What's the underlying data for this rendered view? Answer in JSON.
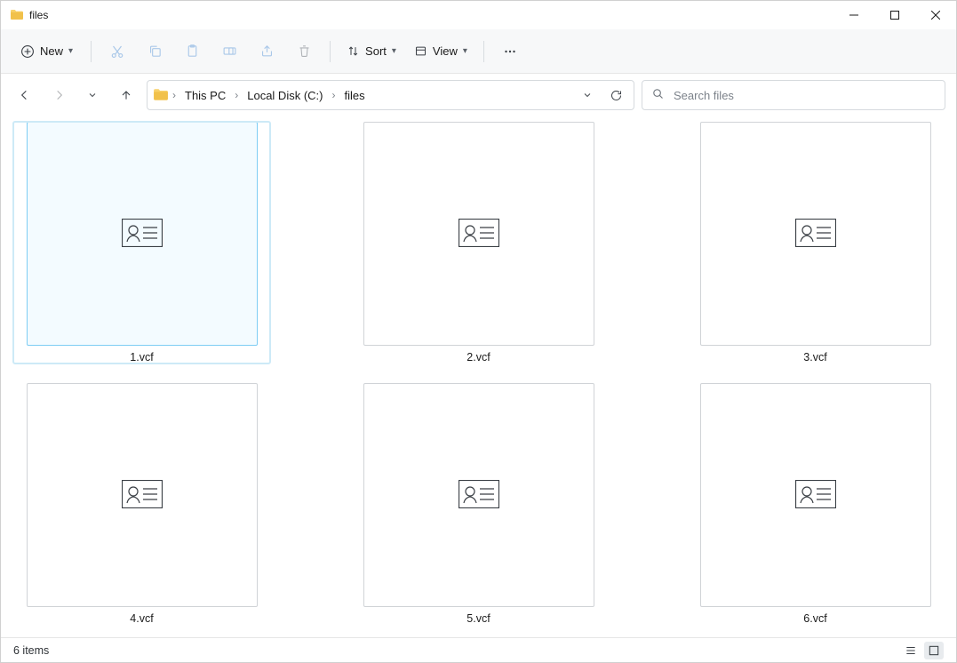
{
  "window": {
    "title": "files"
  },
  "toolbar": {
    "new_label": "New",
    "sort_label": "Sort",
    "view_label": "View"
  },
  "breadcrumbs": {
    "items": [
      "This PC",
      "Local Disk (C:)",
      "files"
    ]
  },
  "search": {
    "placeholder": "Search files"
  },
  "files": {
    "items": [
      {
        "name": "1.vcf",
        "selected": true
      },
      {
        "name": "2.vcf",
        "selected": false
      },
      {
        "name": "3.vcf",
        "selected": false
      },
      {
        "name": "4.vcf",
        "selected": false
      },
      {
        "name": "5.vcf",
        "selected": false
      },
      {
        "name": "6.vcf",
        "selected": false
      }
    ]
  },
  "status": {
    "text": "6 items"
  }
}
